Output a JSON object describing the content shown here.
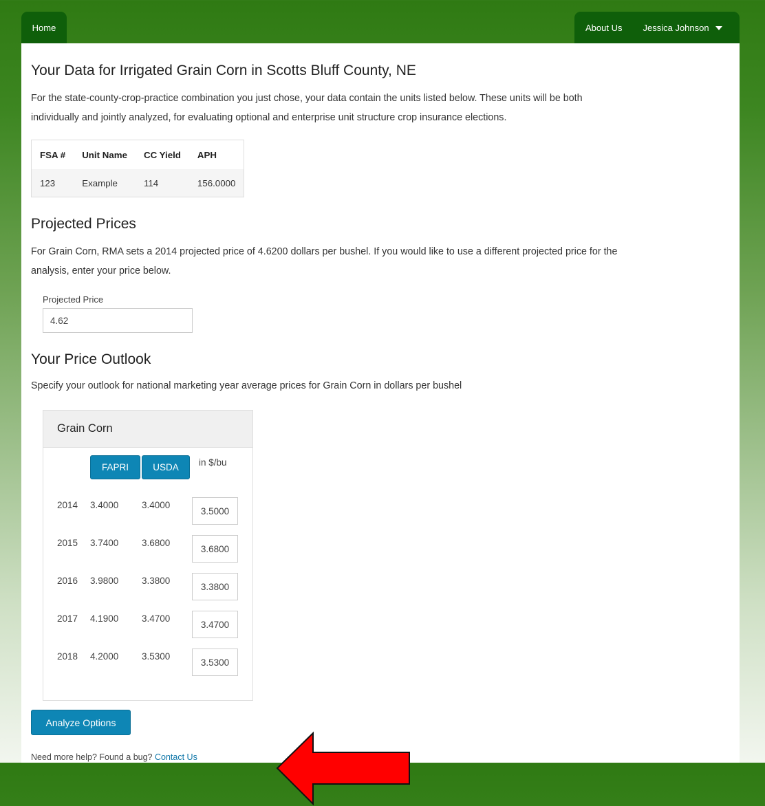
{
  "nav": {
    "home": "Home",
    "about": "About Us",
    "user": "Jessica Johnson"
  },
  "section1": {
    "title": "Your Data for Irrigated Grain Corn in Scotts Bluff County, NE",
    "description_line1": "For the state-county-crop-practice combination you just chose, your data contain the units listed below. These units will be both",
    "description_line2": "individually and jointly analyzed, for evaluating optional and enterprise unit structure crop insurance elections.",
    "table": {
      "headers": [
        "FSA #",
        "Unit Name",
        "CC Yield",
        "APH"
      ],
      "rows": [
        [
          "123",
          "Example",
          "114",
          "156.0000"
        ]
      ]
    }
  },
  "section2": {
    "title": "Projected Prices",
    "description_line1": "For Grain Corn, RMA sets a 2014 projected price of 4.6200 dollars per bushel. If you would like to use a different projected price for the",
    "description_line2": "analysis, enter your price below.",
    "field_label": "Projected Price",
    "field_value": "4.62"
  },
  "section3": {
    "title": "Your Price Outlook",
    "description": "Specify your outlook for national marketing year average prices for Grain Corn in dollars per bushel",
    "panel_title": "Grain Corn",
    "fapri_label": "FAPRI",
    "usda_label": "USDA",
    "unit_label": "in $/bu",
    "rows": [
      {
        "year": "2014",
        "fapri": "3.4000",
        "usda": "3.4000",
        "value": "3.5000"
      },
      {
        "year": "2015",
        "fapri": "3.7400",
        "usda": "3.6800",
        "value": "3.6800"
      },
      {
        "year": "2016",
        "fapri": "3.9800",
        "usda": "3.3800",
        "value": "3.3800"
      },
      {
        "year": "2017",
        "fapri": "4.1900",
        "usda": "3.4700",
        "value": "3.4700"
      },
      {
        "year": "2018",
        "fapri": "4.2000",
        "usda": "3.5300",
        "value": "3.5300"
      }
    ]
  },
  "actions": {
    "analyze_label": "Analyze Options"
  },
  "footer": {
    "help_text": "Need more help? Found a bug? ",
    "contact_link": "Contact Us"
  },
  "colors": {
    "nav_bg": "#0f5f0a",
    "primary_button": "#0e86b5",
    "arrow": "#ff0000"
  }
}
